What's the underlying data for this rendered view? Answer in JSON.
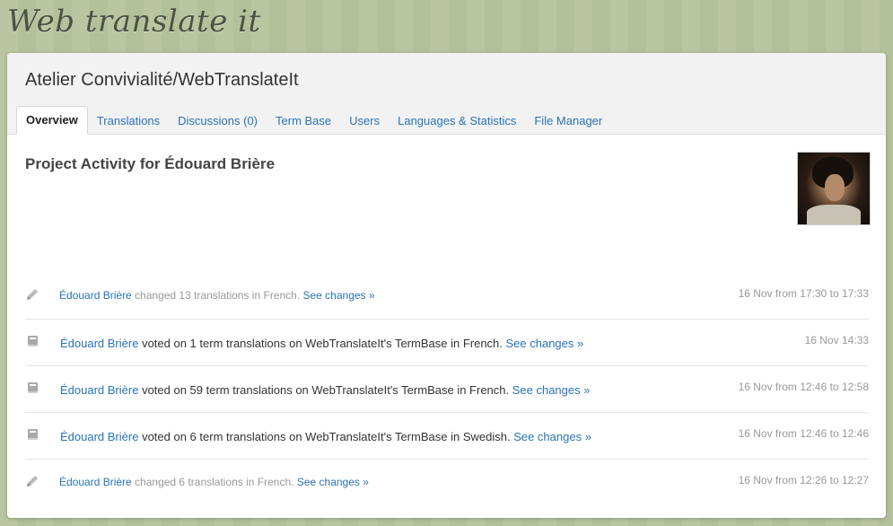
{
  "app": {
    "logo": "Web translate it"
  },
  "project": {
    "title": "Atelier Convivialité/WebTranslateIt"
  },
  "tabs": [
    {
      "label": "Overview",
      "active": true
    },
    {
      "label": "Translations"
    },
    {
      "label": "Discussions (0)"
    },
    {
      "label": "Term Base"
    },
    {
      "label": "Users"
    },
    {
      "label": "Languages & Statistics"
    },
    {
      "label": "File Manager"
    }
  ],
  "activity": {
    "heading": "Project Activity for Édouard Brière",
    "items": [
      {
        "icon": "pencil-icon",
        "user": "Édouard Brière",
        "action": " changed 13 translations in French. ",
        "link": "See changes »",
        "time": "16 Nov from 17:30 to 17:33"
      },
      {
        "icon": "book-icon",
        "user": "Édouard Brière",
        "action": " voted on 1 term translations on WebTranslateIt's TermBase in French. ",
        "link": "See changes »",
        "time": "16 Nov 14:33"
      },
      {
        "icon": "book-icon",
        "user": "Édouard Brière",
        "action": " voted on 59 term translations on WebTranslateIt's TermBase in French. ",
        "link": "See changes »",
        "time": "16 Nov from 12:46 to 12:58"
      },
      {
        "icon": "book-icon",
        "user": "Édouard Brière",
        "action": " voted on 6 term translations on WebTranslateIt's TermBase in Swedish. ",
        "link": "See changes »",
        "time": "16 Nov from 12:46 to 12:46"
      },
      {
        "icon": "pencil-icon",
        "user": "Édouard Brière",
        "action": " changed 6 translations in French. ",
        "link": "See changes »",
        "time": "16 Nov from 12:26 to 12:27"
      }
    ]
  }
}
